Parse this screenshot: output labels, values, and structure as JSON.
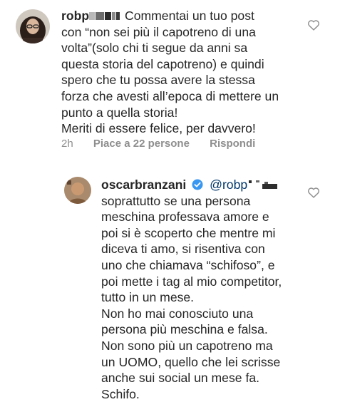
{
  "comment1": {
    "username": "robp",
    "lines": [
      "Commentai un tuo post",
      "con “non sei più il capotreno di una",
      "volta”(solo chi ti segue da anni sa",
      "questa storia del capotreno) e quindi",
      "spero che tu possa avere la stessa",
      "forza che avesti all’epoca di mettere un",
      "punto a quella storia!",
      "Meriti di essere felice, per davvero!"
    ],
    "time": "2h",
    "likes": "Piace a 22 persone",
    "reply": "Rispondi"
  },
  "reply1": {
    "username": "oscarbranzani",
    "mention": "@robp",
    "lines": [
      "soprattutto se una persona",
      "meschina professava amore e",
      "poi si è scoperto che mentre mi",
      "diceva ti amo, si risentiva con",
      "uno che chiamava “schifoso”, e",
      "poi mette i tag al mio competitor,",
      "tutto in un mese.",
      "Non ho mai conosciuto una",
      "persona più meschina e falsa.",
      "Non sono più un capotreno ma",
      "un UOMO, quello che lei scrisse",
      "anche sui social un mese fa.",
      "Schifo."
    ]
  },
  "colors": {
    "text": "#262626",
    "muted": "#8e8e8e",
    "verified": "#3897f0",
    "mention": "#003569"
  },
  "icons": [
    "avatar-robp",
    "heart-icon",
    "avatar-oscarbranzani",
    "verified-badge-icon",
    "heart-icon"
  ]
}
